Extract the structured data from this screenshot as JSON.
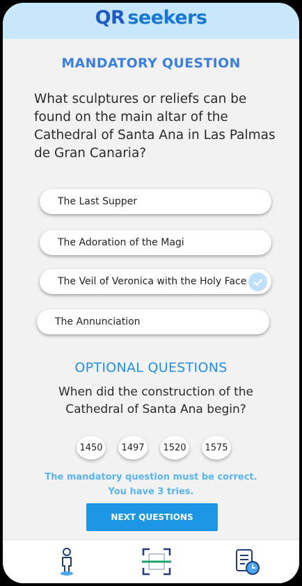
{
  "app": {
    "logo_qr": "QR",
    "logo_text": "seekers"
  },
  "mandatory": {
    "title": "MANDATORY QUESTION",
    "question": "What sculptures or reliefs can be found on the main altar of the Cathedral of Santa Ana in Las Palmas de Gran Canaria?",
    "options": [
      {
        "label": "The Last Supper",
        "selected": false
      },
      {
        "label": "The Adoration of the Magi",
        "selected": false
      },
      {
        "label": "The Veil of Veronica with the Holy Face",
        "selected": true
      },
      {
        "label": "The Annunciation",
        "selected": false
      }
    ]
  },
  "optional": {
    "title": "OPTIONAL QUESTIONS",
    "question": "When did the construction of the Cathedral of Santa Ana begin?",
    "years": [
      "1450",
      "1497",
      "1520",
      "1575"
    ]
  },
  "notice": {
    "line1": "The mandatory question must be correct.",
    "line2": "You have 3 tries."
  },
  "next_button": {
    "label": "NEXT QUESTIONS"
  },
  "nav": {
    "items": [
      "person-icon",
      "qr-scan-icon",
      "history-icon"
    ]
  },
  "colors": {
    "accent": "#1c97e6",
    "header": "#c9e7fb",
    "scan_green": "#1aa36b"
  }
}
